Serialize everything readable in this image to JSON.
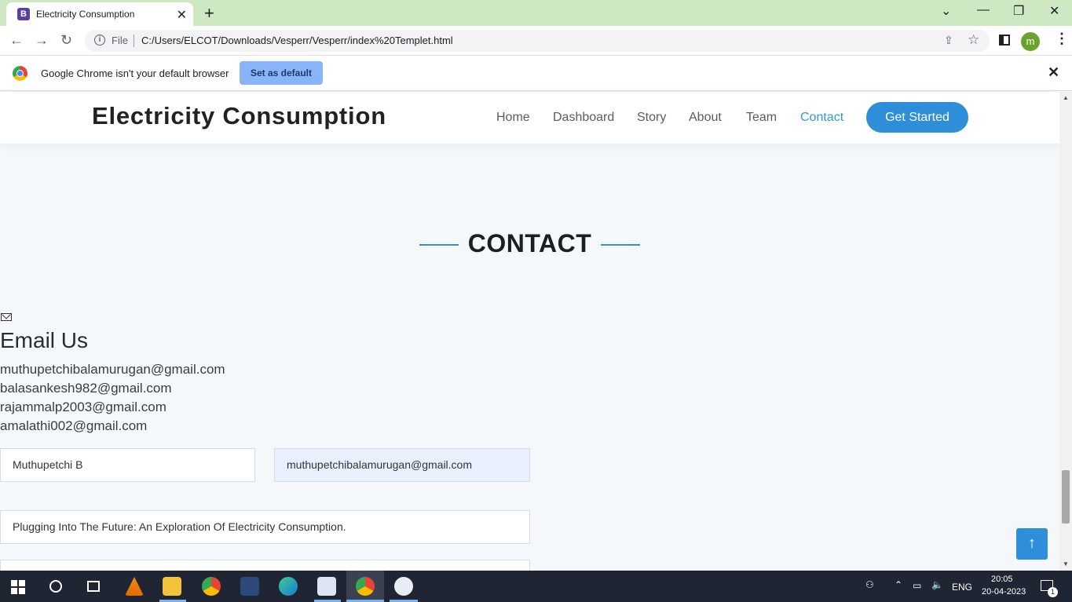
{
  "browser": {
    "tab_title": "Electricity Consumption",
    "tab_favicon_letter": "B",
    "new_tab_symbol": "+",
    "url_scheme_label": "File",
    "url": "C:/Users/ELCOT/Downloads/Vesperr/Vesperr/index%20Templet.html",
    "profile_initial": "m",
    "infobar_message": "Google Chrome isn't your default browser",
    "infobar_button": "Set as default"
  },
  "site": {
    "logo": "Electricity Consumption",
    "nav": [
      "Home",
      "Dashboard",
      "Story",
      "About",
      "Team",
      "Contact"
    ],
    "active_nav": "Contact",
    "cta": "Get Started",
    "section_title": "CONTACT",
    "email_heading": "Email Us",
    "emails": [
      "muthupetchibalamurugan@gmail.com",
      "balasankesh982@gmail.com",
      "rajammalp2003@gmail.com",
      "amalathi002@gmail.com"
    ],
    "form": {
      "name_value": "Muthupetchi B",
      "email_value": "muthupetchibalamurugan@gmail.com",
      "subject_value": "Plugging Into The Future:  An Exploration Of Electricity Consumption."
    },
    "back_to_top_icon": "arrow-up-icon"
  },
  "taskbar": {
    "language": "ENG",
    "time": "20:05",
    "date": "20-04-2023",
    "notification_count": "1"
  },
  "colors": {
    "accent": "#2e8fd8",
    "active_nav": "#3498db",
    "tab_strip": "#cfe8c4",
    "taskbar": "#1f2533"
  }
}
